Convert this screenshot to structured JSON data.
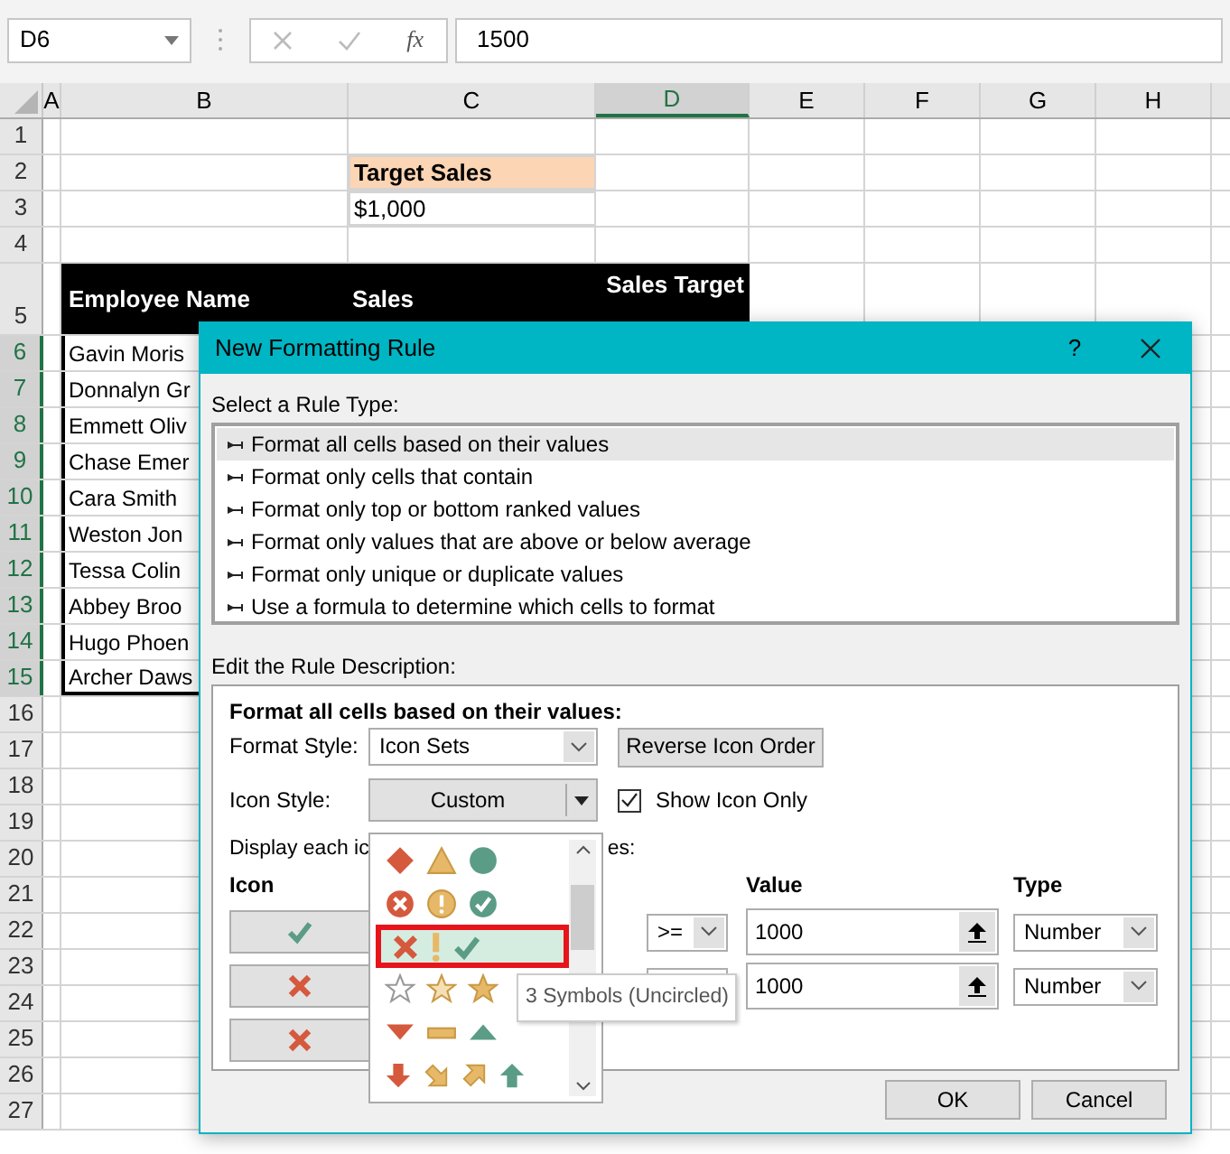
{
  "name_box": "D6",
  "formula_label": "fx",
  "formula": "1500",
  "columns": [
    {
      "label": "A",
      "selected": false
    },
    {
      "label": "B",
      "selected": false
    },
    {
      "label": "C",
      "selected": false
    },
    {
      "label": "D",
      "selected": true
    },
    {
      "label": "E",
      "selected": false
    },
    {
      "label": "F",
      "selected": false
    },
    {
      "label": "G",
      "selected": false
    },
    {
      "label": "H",
      "selected": false
    }
  ],
  "rows": [
    {
      "label": "1",
      "selected": false
    },
    {
      "label": "2",
      "selected": false
    },
    {
      "label": "3",
      "selected": false
    },
    {
      "label": "4",
      "selected": false
    },
    {
      "label": "5",
      "selected": false
    },
    {
      "label": "6",
      "selected": true
    },
    {
      "label": "7",
      "selected": true
    },
    {
      "label": "8",
      "selected": true
    },
    {
      "label": "9",
      "selected": true
    },
    {
      "label": "10",
      "selected": true
    },
    {
      "label": "11",
      "selected": true
    },
    {
      "label": "12",
      "selected": true
    },
    {
      "label": "13",
      "selected": true
    },
    {
      "label": "14",
      "selected": true
    },
    {
      "label": "15",
      "selected": true
    },
    {
      "label": "16",
      "selected": false
    },
    {
      "label": "17",
      "selected": false
    },
    {
      "label": "18",
      "selected": false
    },
    {
      "label": "19",
      "selected": false
    },
    {
      "label": "20",
      "selected": false
    },
    {
      "label": "21",
      "selected": false
    },
    {
      "label": "22",
      "selected": false
    },
    {
      "label": "23",
      "selected": false
    },
    {
      "label": "24",
      "selected": false
    },
    {
      "label": "25",
      "selected": false
    },
    {
      "label": "26",
      "selected": false
    },
    {
      "label": "27",
      "selected": false
    }
  ],
  "target": {
    "label": "Target Sales",
    "value": "$1,000"
  },
  "table": {
    "columns": [
      "Employee Name",
      "Sales",
      "Sales Target"
    ],
    "names": [
      "Gavin Moris",
      "Donnalyn Gr",
      "Emmett Oliv",
      "Chase Emer",
      "Cara Smith",
      "Weston Jon",
      "Tessa Colin",
      "Abbey Broo",
      "Hugo Phoen",
      "Archer Daws"
    ]
  },
  "dialog": {
    "title": "New Formatting Rule",
    "help": "?",
    "rule_type_label": "Select a Rule Type:",
    "rule_types": [
      {
        "label": "Format all cells based on their values",
        "selected": true
      },
      {
        "label": "Format only cells that contain",
        "selected": false
      },
      {
        "label": "Format only top or bottom ranked values",
        "selected": false
      },
      {
        "label": "Format only values that are above or below average",
        "selected": false
      },
      {
        "label": "Format only unique or duplicate values",
        "selected": false
      },
      {
        "label": "Use a formula to determine which cells to format",
        "selected": false
      }
    ],
    "description_label": "Edit the Rule Description:",
    "description_heading": "Format all cells based on their values:",
    "format_style": {
      "label": "Format Style:",
      "value": "Icon Sets"
    },
    "reverse_button": "Reverse Icon Order",
    "icon_style": {
      "label": "Icon Style:",
      "value": "Custom"
    },
    "show_icon_only": {
      "label": "Show Icon Only",
      "checked": true
    },
    "display_text": [
      "Display each ic",
      "es:"
    ],
    "headers": {
      "icon": "Icon",
      "value": "Value",
      "type": "Type"
    },
    "rules": [
      {
        "kind": "check",
        "operator": ">=",
        "value": "1000",
        "type": "Number"
      },
      {
        "kind": "cross",
        "value": "1000",
        "type": "Number"
      },
      {
        "kind": "cross"
      }
    ],
    "icon_sets": [
      {
        "kind": "shapes",
        "selected": false
      },
      {
        "kind": "circled-symbols",
        "selected": false
      },
      {
        "kind": "symbols",
        "selected": true
      },
      {
        "kind": "stars",
        "selected": false
      },
      {
        "kind": "triangles",
        "selected": false
      },
      {
        "kind": "arrows",
        "selected": false
      }
    ],
    "tooltip": "3 Symbols (Uncircled)",
    "buttons": [
      "OK",
      "Cancel"
    ]
  }
}
